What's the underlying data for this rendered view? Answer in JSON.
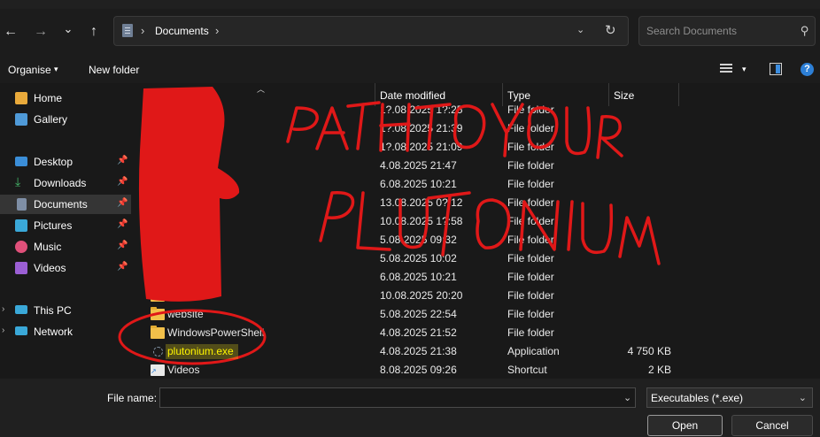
{
  "navigation": {
    "back_glyph": "←",
    "forward_glyph": "→",
    "recent_glyph": "⌄",
    "up_glyph": "↑"
  },
  "address": {
    "separator": "›",
    "path": "Documents",
    "dropdown_glyph": "⌄",
    "refresh_glyph": "↻"
  },
  "search": {
    "placeholder": "Search Documents",
    "icon": "⚲"
  },
  "commandbar": {
    "organise": "Organise",
    "new_folder": "New folder",
    "caret": "▾",
    "help": "?"
  },
  "sidebar": {
    "pin_glyph": "📌",
    "expand_glyph": "›",
    "items": [
      {
        "label": "Home",
        "icon": "home-icon",
        "color": "#e9aa3b"
      },
      {
        "label": "Gallery",
        "icon": "gallery-icon",
        "color": "#4f9ad8"
      },
      {
        "label": "Desktop",
        "icon": "desktop-icon",
        "color": "#3b8ed8"
      },
      {
        "label": "Downloads",
        "icon": "downloads-icon",
        "color": "#46b86a"
      },
      {
        "label": "Documents",
        "icon": "documents-icon",
        "color": "#7f8fa6"
      },
      {
        "label": "Pictures",
        "icon": "pictures-icon",
        "color": "#3aa8d8"
      },
      {
        "label": "Music",
        "icon": "music-icon",
        "color": "#e0507a"
      },
      {
        "label": "Videos",
        "icon": "videos-icon",
        "color": "#9b5fd4"
      },
      {
        "label": "This PC",
        "icon": "this-pc-icon",
        "color": "#3aa8d8"
      },
      {
        "label": "Network",
        "icon": "network-icon",
        "color": "#3aa8d8"
      }
    ]
  },
  "columns": {
    "name": "Name",
    "date": "Date modified",
    "type": "Type",
    "size": "Size"
  },
  "files": [
    {
      "name": "",
      "date": "1?.08.2025 1?:25",
      "type": "File folder",
      "size": ""
    },
    {
      "name": "",
      "date": "1?.08.2025 21:39",
      "type": "File folder",
      "size": ""
    },
    {
      "name": "",
      "date": "1?.08.2025 21:09",
      "type": "File folder",
      "size": ""
    },
    {
      "name": "",
      "date": "4.08.2025 21:47",
      "type": "File folder",
      "size": ""
    },
    {
      "name": "",
      "date": "6.08.2025 10:21",
      "type": "File folder",
      "size": ""
    },
    {
      "name": "",
      "date": "13.08.2025 0?:12",
      "type": "File folder",
      "size": ""
    },
    {
      "name": "",
      "date": "10.08.2025 1?:58",
      "type": "File folder",
      "size": ""
    },
    {
      "name": "",
      "date": "5.08.2025 09:32",
      "type": "File folder",
      "size": ""
    },
    {
      "name": "",
      "date": "5.08.2025 10:02",
      "type": "File folder",
      "size": ""
    },
    {
      "name": "",
      "date": "6.08.2025 10:21",
      "type": "File folder",
      "size": ""
    },
    {
      "name": "",
      "date": "10.08.2025 20:20",
      "type": "File folder",
      "size": ""
    },
    {
      "name": "website",
      "date": "5.08.2025 22:54",
      "type": "File folder",
      "size": ""
    },
    {
      "name": "WindowsPowerShell",
      "date": "4.08.2025 21:52",
      "type": "File folder",
      "size": ""
    },
    {
      "name": "plutonium.exe",
      "date": "4.08.2025 21:38",
      "type": "Application",
      "size": "4 750 KB"
    },
    {
      "name": "Videos",
      "date": "8.08.2025 09:26",
      "type": "Shortcut",
      "size": "2 KB"
    }
  ],
  "bottom": {
    "file_name_label": "File name:",
    "file_name_value": "",
    "file_type": "Executables (*.exe)",
    "dropdown_glyph": "⌄",
    "open": "Open",
    "cancel": "Cancel"
  },
  "annotation": {
    "color": "#e01818"
  }
}
